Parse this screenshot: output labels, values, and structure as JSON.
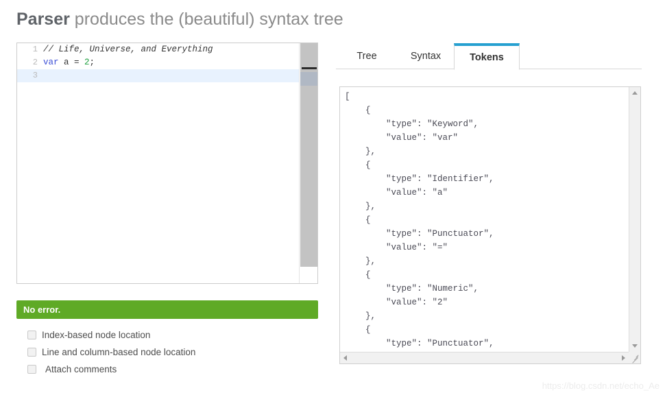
{
  "page": {
    "title_strong": "Parser",
    "title_rest": " produces the (beautiful) syntax tree",
    "watermark": "https://blog.csdn.net/echo_Ae"
  },
  "editor": {
    "lines": [
      {
        "number": "1",
        "text": "// Life, Universe, and Everything",
        "kind": "comment"
      },
      {
        "number": "2",
        "text": "var a = 2;",
        "kind": "code"
      },
      {
        "number": "3",
        "text": "",
        "kind": "empty"
      }
    ],
    "line1_comment": "// Life, Universe, and Everything",
    "line2_keyword": "var",
    "line2_mid": " a = ",
    "line2_number": "2",
    "line2_semicolon": ";",
    "line_number_1": "1",
    "line_number_2": "2",
    "line_number_3": "3"
  },
  "status": {
    "message": "No error.",
    "color": "#5faa26"
  },
  "options": [
    {
      "label": "Index-based node location",
      "checked": false
    },
    {
      "label": "Line and column-based node location",
      "checked": false
    },
    {
      "label": "Attach comments",
      "checked": false
    }
  ],
  "tabs": {
    "active_index": 2,
    "accent_color": "#26a0d0",
    "items": [
      {
        "label": "Tree"
      },
      {
        "label": "Syntax"
      },
      {
        "label": "Tokens"
      }
    ]
  },
  "output": {
    "tokens": [
      {
        "type": "Keyword",
        "value": "var"
      },
      {
        "type": "Identifier",
        "value": "a"
      },
      {
        "type": "Punctuator",
        "value": "="
      },
      {
        "type": "Numeric",
        "value": "2"
      },
      {
        "type": "Punctuator",
        "value": ";"
      }
    ],
    "text": "[\n    {\n        \"type\": \"Keyword\",\n        \"value\": \"var\"\n    },\n    {\n        \"type\": \"Identifier\",\n        \"value\": \"a\"\n    },\n    {\n        \"type\": \"Punctuator\",\n        \"value\": \"=\"\n    },\n    {\n        \"type\": \"Numeric\",\n        \"value\": \"2\"\n    },\n    {\n        \"type\": \"Punctuator\",\n        \"value\": \";\"\n    }\n]"
  }
}
